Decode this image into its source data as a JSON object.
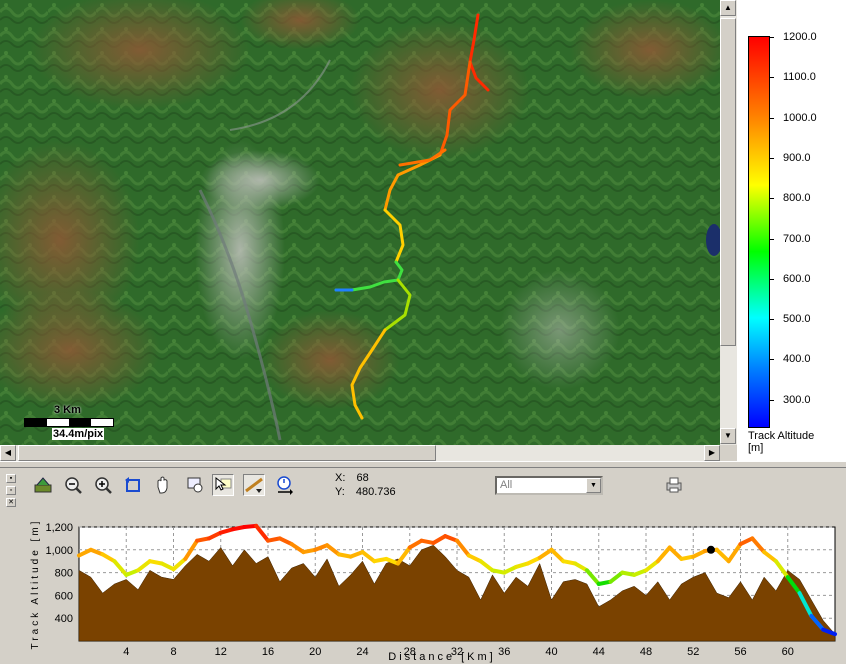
{
  "map": {
    "scale_label": "3 Km",
    "resolution": "34.4m/pix"
  },
  "legend": {
    "ticks": [
      "1200.0",
      "1100.0",
      "1000.0",
      "900.0",
      "800.0",
      "700.0",
      "600.0",
      "500.0",
      "400.0",
      "300.0"
    ],
    "title": "Track Altitude",
    "unit": "[m]"
  },
  "toolbar": {
    "tools": [
      "layers-icon",
      "zoom-out-icon",
      "zoom-in-icon",
      "rotate-icon",
      "pan-hand-icon",
      "zoom-box-icon",
      "select-arrow-icon",
      "track-tool-icon",
      "time-icon"
    ],
    "x_label": "X:",
    "x_value": "68",
    "y_label": "Y:",
    "y_value": "480.736",
    "filter_value": "All"
  },
  "chart_data": {
    "type": "area",
    "xlabel": "Distance [Km]",
    "ylabel": "Track Altitude [m]",
    "xlim": [
      0,
      64
    ],
    "ylim": [
      200,
      1200
    ],
    "xticks": [
      4,
      8,
      12,
      16,
      20,
      24,
      28,
      32,
      36,
      40,
      44,
      48,
      52,
      56,
      60
    ],
    "yticks": [
      400,
      600,
      800,
      1000,
      1200
    ],
    "ytick_labels": [
      "400",
      "600",
      "800",
      "1,000",
      "1,200"
    ],
    "series": [
      {
        "kind": "track_altitude",
        "x": [
          0,
          1,
          2,
          3,
          4,
          5,
          6,
          7,
          8,
          9,
          10,
          11,
          12,
          13,
          14,
          15,
          16,
          17,
          18,
          19,
          20,
          21,
          22,
          23,
          24,
          25,
          26,
          27,
          28,
          29,
          30,
          31,
          32,
          33,
          34,
          35,
          36,
          37,
          38,
          39,
          40,
          41,
          42,
          43,
          44,
          45,
          46,
          47,
          48,
          49,
          50,
          51,
          52,
          53,
          54,
          55,
          56,
          57,
          58,
          59,
          60,
          61,
          62,
          63,
          64
        ],
        "y": [
          950,
          1000,
          960,
          900,
          780,
          820,
          900,
          880,
          830,
          920,
          1080,
          1100,
          1150,
          1180,
          1200,
          1210,
          1080,
          1100,
          1050,
          980,
          1000,
          1040,
          960,
          940,
          980,
          900,
          920,
          880,
          1020,
          1080,
          1060,
          1120,
          1080,
          950,
          900,
          820,
          800,
          850,
          880,
          930,
          1000,
          900,
          880,
          820,
          700,
          720,
          800,
          780,
          820,
          900,
          1020,
          920,
          940,
          990,
          1000,
          900,
          1050,
          1100,
          980,
          900,
          760,
          620,
          420,
          300,
          260
        ]
      },
      {
        "kind": "terrain",
        "x": [
          0,
          1,
          2,
          3,
          4,
          5,
          6,
          7,
          8,
          9,
          10,
          11,
          12,
          13,
          14,
          15,
          16,
          17,
          18,
          19,
          20,
          21,
          22,
          23,
          24,
          25,
          26,
          27,
          28,
          29,
          30,
          31,
          32,
          33,
          34,
          35,
          36,
          37,
          38,
          39,
          40,
          41,
          42,
          43,
          44,
          45,
          46,
          47,
          48,
          49,
          50,
          51,
          52,
          53,
          54,
          55,
          56,
          57,
          58,
          59,
          60,
          61,
          62,
          63,
          64
        ],
        "y": [
          820,
          760,
          620,
          700,
          740,
          650,
          820,
          760,
          740,
          860,
          960,
          900,
          1020,
          860,
          1000,
          880,
          940,
          720,
          840,
          880,
          760,
          920,
          680,
          780,
          900,
          700,
          880,
          920,
          860,
          1000,
          1040,
          940,
          820,
          760,
          560,
          780,
          620,
          760,
          680,
          880,
          560,
          720,
          740,
          700,
          500,
          560,
          640,
          680,
          600,
          720,
          560,
          700,
          760,
          800,
          620,
          580,
          720,
          560,
          760,
          640,
          820,
          740,
          560,
          380,
          260
        ]
      }
    ],
    "marker": {
      "x": 53.5,
      "y": 1000
    }
  }
}
